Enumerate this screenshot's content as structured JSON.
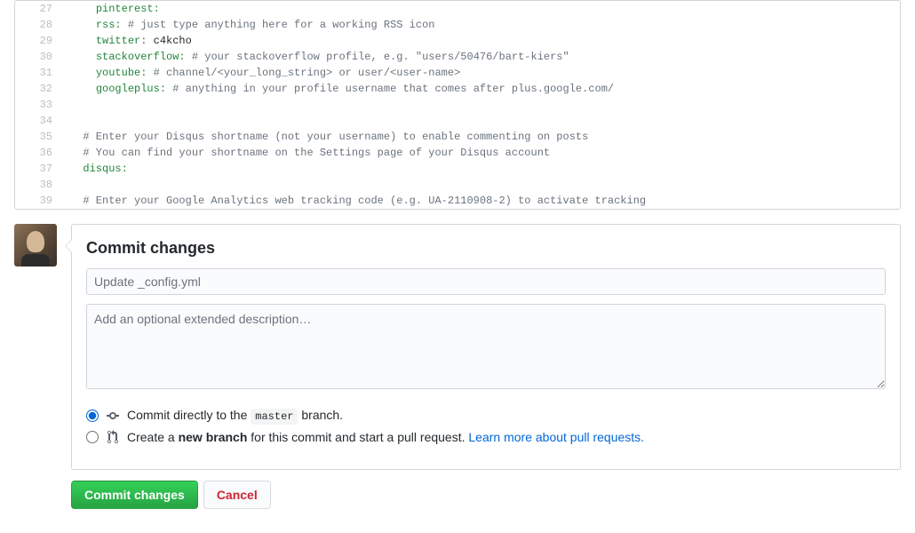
{
  "code": {
    "lines": [
      {
        "n": 27,
        "indent": 4,
        "key": "pinterest:",
        "rest": ""
      },
      {
        "n": 28,
        "indent": 4,
        "key": "rss:",
        "rest": " # just type anything here for a working RSS icon",
        "comment": true
      },
      {
        "n": 29,
        "indent": 4,
        "key": "twitter:",
        "rest": " c4kcho"
      },
      {
        "n": 30,
        "indent": 4,
        "key": "stackoverflow:",
        "rest": " # your stackoverflow profile, e.g. \"users/50476/bart-kiers\"",
        "comment": true
      },
      {
        "n": 31,
        "indent": 4,
        "key": "youtube:",
        "rest": " # channel/<your_long_string> or user/<user-name>",
        "comment": true
      },
      {
        "n": 32,
        "indent": 4,
        "key": "googleplus:",
        "rest": " # anything in your profile username that comes after plus.google.com/",
        "comment": true
      },
      {
        "n": 33,
        "indent": 0,
        "key": "",
        "rest": ""
      },
      {
        "n": 34,
        "indent": 0,
        "key": "",
        "rest": ""
      },
      {
        "n": 35,
        "indent": 2,
        "key": "",
        "rest": "# Enter your Disqus shortname (not your username) to enable commenting on posts",
        "comment": true
      },
      {
        "n": 36,
        "indent": 2,
        "key": "",
        "rest": "# You can find your shortname on the Settings page of your Disqus account",
        "comment": true
      },
      {
        "n": 37,
        "indent": 2,
        "key": "disqus:",
        "rest": ""
      },
      {
        "n": 38,
        "indent": 0,
        "key": "",
        "rest": ""
      },
      {
        "n": 39,
        "indent": 2,
        "key": "",
        "rest": "# Enter your Google Analytics web tracking code (e.g. UA-2110908-2) to activate tracking",
        "comment": true
      }
    ]
  },
  "commit": {
    "title": "Commit changes",
    "message_placeholder": "Update _config.yml",
    "description_placeholder": "Add an optional extended description…",
    "direct_prefix": "Commit directly to the ",
    "direct_branch": "master",
    "direct_suffix": " branch.",
    "newbranch_prefix": "Create a ",
    "newbranch_bold": "new branch",
    "newbranch_suffix": " for this commit and start a pull request. ",
    "learn_more": "Learn more about pull requests.",
    "commit_button": "Commit changes",
    "cancel_button": "Cancel"
  }
}
